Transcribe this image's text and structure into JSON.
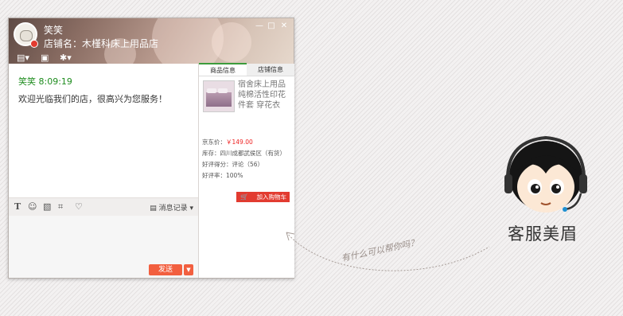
{
  "window": {
    "contact_name": "笑笑",
    "shop_label": "店铺名：木槿科床上用品店",
    "controls": {
      "minimize": "—",
      "maximize": "□",
      "close": "✕"
    }
  },
  "chat": {
    "sender": "笑笑",
    "time": "8:09:19",
    "message": "欢迎光临我们的店，很高兴为您服务！"
  },
  "edit_bar": {
    "history_label": "消息记录"
  },
  "bottom": {
    "send_label": "发送",
    "more_label": "▼"
  },
  "side": {
    "tabs": [
      "商品信息",
      "店铺信息"
    ],
    "product_title": "宿舍床上用品纯棉活性印花件套 穿花衣",
    "price_label": "京东价：",
    "price_value": "￥149.00",
    "stock": "库存：四川成都武侯区（有货）",
    "rating": "好评得分：评论（56）",
    "rate": "好评率：100%",
    "cart_label": "加入购物车"
  },
  "note": "有什么可以帮你吗？",
  "mascot_title": "客服美眉",
  "colors": {
    "accent": "#e23b30",
    "green": "#1e8c1e",
    "send": "#f25f3f"
  }
}
